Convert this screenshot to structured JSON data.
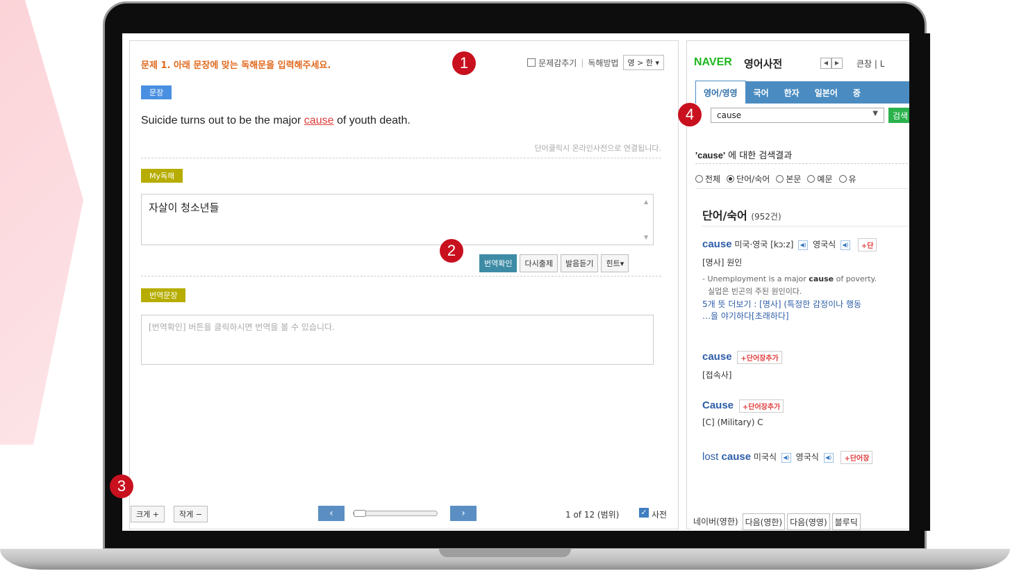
{
  "question": {
    "title": "문제 1. 아래 문장에 맞는 독해문을 입력해주세요.",
    "hide_label": "문제감추기",
    "method_label": "독해방법",
    "method_value": "영 > 한 ▾"
  },
  "sentence": {
    "tag": "문장",
    "before": "Suicide turns out to be the major ",
    "highlight": "cause",
    "after": " of youth death.",
    "dict_note": "단어클릭시 온라인사전으로 연결됩니다."
  },
  "my_translation": {
    "tag": "My독해",
    "value": "자살이 청소년들"
  },
  "buttons": {
    "check": "번역확인",
    "retry": "다시출제",
    "listen": "발음듣기",
    "hint": "힌트▾"
  },
  "result": {
    "tag": "번역문장",
    "placeholder": "[번역확인] 버튼을 클릭하시면 번역을 볼 수 있습니다."
  },
  "bottom": {
    "bigger": "크게 +",
    "smaller": "작게 −",
    "prev": "‹",
    "next": "›",
    "slider_value": 0,
    "page": "1 of 12 (범위)",
    "dict_label": "사전"
  },
  "dictionary": {
    "logo": "NAVER",
    "title": "영어사전",
    "big_window": "큰창 | L",
    "tabs": [
      "영어/영영",
      "국어",
      "한자",
      "일본어",
      "중"
    ],
    "search_value": "cause",
    "search_btn": "검색",
    "result_head_word": "'cause'",
    "result_head_rest": " 에 대한 검색결과",
    "filters": [
      "전체",
      "단어/숙어",
      "본문",
      "예문",
      "유"
    ],
    "section_title": "단어/숙어",
    "section_count": "(952건)",
    "entry1": {
      "word": "cause",
      "pron": "미국·영국 [kɔːz]",
      "uk": "영국식",
      "add": "+단",
      "pos": "[명사] 원인",
      "ex_en_pre": "- Unemployment is a major ",
      "ex_en_bold": "cause",
      "ex_en_post": " of poverty.",
      "ex_ko": "실업은 빈곤의 주된 원인이다.",
      "more1": "5개 뜻 더보기 : [명사] (특정한 감정이나 행동",
      "more2": "…을 야기하다[초래하다]"
    },
    "entry2": {
      "word": "cause",
      "add": "+단어장추가",
      "pos": "[접속사]"
    },
    "entry3": {
      "word": "Cause",
      "add": "+단어장추가",
      "pos": "[C] (Military) C"
    },
    "entry4": {
      "word_pre": "lost ",
      "word": "cause",
      "us": "미국식",
      "uk": "영국식",
      "add": "+단어장"
    },
    "bottom_tabs": [
      "네이버(영한)",
      "다음(영한)",
      "다음(영영)",
      "블루딕"
    ]
  },
  "markers": [
    "1",
    "2",
    "3",
    "4"
  ],
  "colors": {
    "accent": "#c8101e",
    "naver_green": "#1eb71e",
    "tab_blue": "#4a8cc2",
    "title_orange": "#e06a1f"
  }
}
